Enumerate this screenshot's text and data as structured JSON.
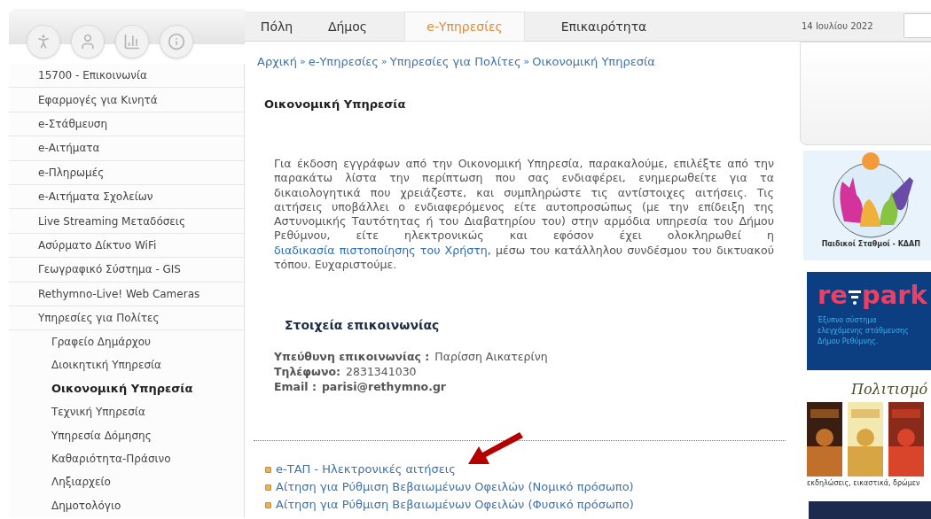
{
  "nav_tabs": [
    {
      "label": "Πόλη",
      "selected": false
    },
    {
      "label": "Δήμος",
      "selected": false
    },
    {
      "label": "e-Υπηρεσίες",
      "selected": true
    },
    {
      "label": "Επικαιρότητα",
      "selected": false
    }
  ],
  "date": "14 Ιουλίου 2022",
  "sidebar": {
    "items": [
      {
        "label": "15700 - Επικοινωνία",
        "selected": false
      },
      {
        "label": "Εφαρμογές για Κινητά",
        "selected": false
      },
      {
        "label": "e-Στάθμευση",
        "selected": false
      },
      {
        "label": "e-Αιτήματα",
        "selected": false
      },
      {
        "label": "e-Πληρωμές",
        "selected": false
      },
      {
        "label": "e-Αιτήματα Σχολείων",
        "selected": false
      },
      {
        "label": "Live Streaming Μεταδόσεις",
        "selected": false
      },
      {
        "label": "Ασύρματο Δίκτυο WiFi",
        "selected": false
      },
      {
        "label": "Γεωγραφικό Σύστημα - GIS",
        "selected": false
      },
      {
        "label": "Rethymno-Live! Web Cameras",
        "selected": false
      },
      {
        "label": "Υπηρεσίες για Πολίτες",
        "selected": false,
        "children": [
          {
            "label": "Γραφείο Δημάρχου",
            "selected": false
          },
          {
            "label": "Διοικητική Υπηρεσία",
            "selected": false
          },
          {
            "label": "Οικονομική Υπηρεσία",
            "selected": true
          },
          {
            "label": "Τεχνική Υπηρεσία",
            "selected": false
          },
          {
            "label": "Υπηρεσία Δόμησης",
            "selected": false
          },
          {
            "label": "Καθαριότητα-Πράσινο",
            "selected": false
          },
          {
            "label": "Ληξιαρχείο",
            "selected": false
          },
          {
            "label": "Δημοτολόγιο",
            "selected": false
          }
        ]
      }
    ]
  },
  "breadcrumb": {
    "separator": "»",
    "items": [
      "Αρχική",
      "e-Υπηρεσίες",
      "Υπηρεσίες για Πολίτες",
      "Οικονομική Υπηρεσία"
    ]
  },
  "page_title": "Οικονομική Υπηρεσία",
  "intro": {
    "before": "Για έκδοση εγγράφων από την Οικονομική Υπηρεσία, παρακαλούμε, επιλέξτε από την παρακάτω λίστα την περίπτωση που σας ενδιαφέρει, ενημερωθείτε για τα δικαιολογητικά που χρειάζεστε, και συμπληρώστε τις αντίστοιχες αιτήσεις. Τις αιτήσεις υποβάλλει ο ενδιαφερόμενος είτε αυτοπροσώπως (με την επίδειξη της Αστυνομικής Ταυτότητας ή του Διαβατηρίου του) στην αρμόδια υπηρεσία του Δήμου Ρεθύμνου, είτε ηλεκτρονικώς και εφόσον έχει ολοκληρωθεί η ",
    "link": "διαδικασία πιστοποίησης του Χρήστη",
    "after": ", μέσω του κατάλληλου συνδέσμου του δικτυακού τόπου. Ευχαριστούμε."
  },
  "contact": {
    "heading": "Στοιχεία επικοινωνίας",
    "rows": [
      {
        "label": "Υπεύθυνη επικοινωνίας :",
        "value": "Παρίσση Αικατερίνη",
        "value_bold": false
      },
      {
        "label": "Τηλέφωνο:",
        "value": "2831341030",
        "value_bold": false
      },
      {
        "label": "Email :",
        "value": "parisi@rethymno.gr",
        "value_bold": true
      }
    ]
  },
  "links": [
    "e-ΤΑΠ - Ηλεκτρονικές αιτήσεις",
    "Αίτηση για Ρύθμιση Βεβαιωμένων Οφειλών (Νομικό πρόσωπο)",
    "Αίτηση για Ρύθμιση Βεβαιωμένων Οφειλών (Φυσικό πρόσωπο)"
  ],
  "banners": [
    {
      "kind": "kids",
      "caption": "Παιδικοί Σταθμοί - ΚΔΑΠ"
    },
    {
      "kind": "repark",
      "logo_left": "re",
      "logo_right": "park",
      "lines": [
        "Έξυπνο σύστημα",
        "ελεγχόμενης στάθμευσης",
        "Δήμου Ρεθύμνης."
      ]
    },
    {
      "kind": "culture",
      "title": "Πολιτισμό",
      "caption": "εκδηλώσεις, εικαστικά, δρώμεν"
    }
  ]
}
